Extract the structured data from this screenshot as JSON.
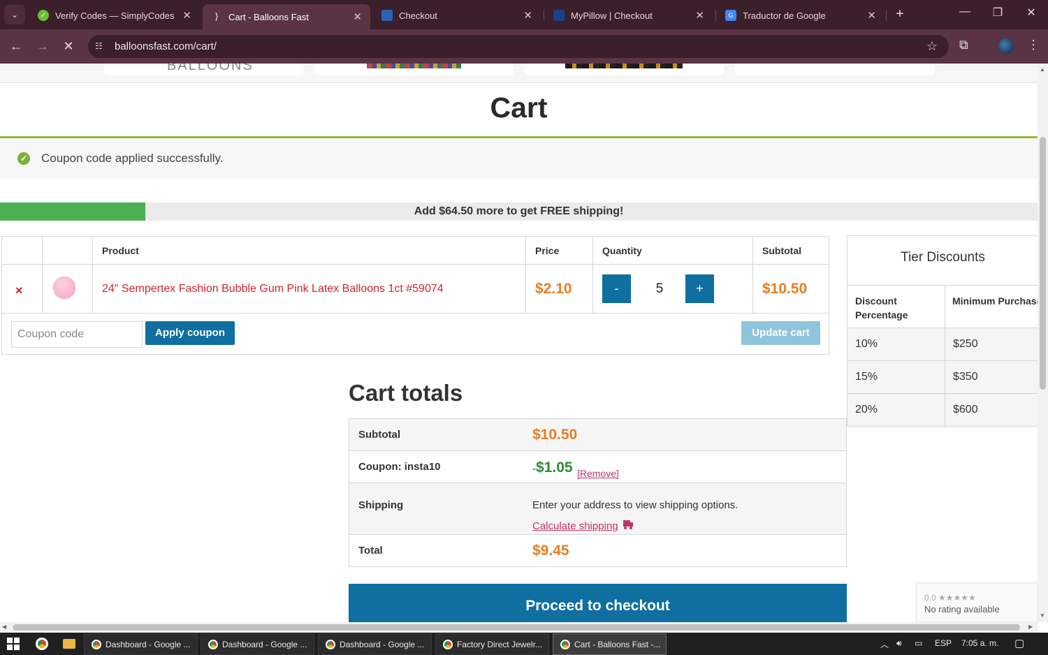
{
  "browser": {
    "tabs": [
      {
        "title": "Verify Codes — SimplyCodes",
        "active": false
      },
      {
        "title": "Cart - Balloons Fast",
        "active": true
      },
      {
        "title": "Checkout",
        "active": false
      },
      {
        "title": "MyPillow | Checkout",
        "active": false
      },
      {
        "title": "Traductor de Google",
        "active": false
      }
    ],
    "url": "balloonsfast.com/cart/",
    "icons": {
      "back": "back-arrow-icon",
      "forward": "forward-arrow-icon",
      "stop": "stop-loading-icon",
      "bookmark": "star-icon",
      "extensions": "puzzle-icon",
      "menu": "kebab-menu-icon"
    },
    "theme_color": "#5a3444"
  },
  "page": {
    "top_logo_text": "BALLOONS",
    "title": "Cart",
    "notice": "Coupon code applied successfully.",
    "shipping_progress": {
      "message": "Add $64.50 more to get FREE shipping!",
      "fraction": 0.14
    }
  },
  "cart_table": {
    "headers": {
      "product": "Product",
      "price": "Price",
      "quantity": "Quantity",
      "subtotal": "Subtotal"
    },
    "item": {
      "remove": "×",
      "name": "24\" Sempertex Fashion Bubble Gum Pink Latex Balloons 1ct #59074",
      "price": "$2.10",
      "qty_minus": "-",
      "quantity": "5",
      "qty_plus": "+",
      "subtotal": "$10.50"
    },
    "coupon_placeholder": "Coupon code",
    "apply_coupon": "Apply coupon",
    "update_cart": "Update cart"
  },
  "tier_discounts": {
    "title": "Tier Discounts",
    "col_discount": "Discount Percentage",
    "col_min": "Minimum Purchase Amt",
    "rows": [
      {
        "pct": "10%",
        "min": "$250"
      },
      {
        "pct": "15%",
        "min": "$350"
      },
      {
        "pct": "20%",
        "min": "$600"
      }
    ]
  },
  "cart_totals": {
    "title": "Cart totals",
    "subtotal_label": "Subtotal",
    "subtotal": "$10.50",
    "coupon_label": "Coupon: insta10",
    "coupon_sign": "-",
    "coupon_amount": "$1.05",
    "remove_label": "[Remove]",
    "shipping_label": "Shipping",
    "shipping_note": "Enter your address to view shipping options.",
    "calculate_shipping": "Calculate shipping",
    "total_label": "Total",
    "total": "$9.45",
    "proceed": "Proceed to checkout"
  },
  "rating_widget": {
    "score": "0.0 ★★★★★",
    "text": "No rating available"
  },
  "taskbar": {
    "items": [
      {
        "title": "Dashboard - Google ...",
        "active": false
      },
      {
        "title": "Dashboard - Google ...",
        "active": false
      },
      {
        "title": "Dashboard - Google ...",
        "active": false
      },
      {
        "title": "Factory Direct Jewelr...",
        "active": false
      },
      {
        "title": "Cart - Balloons Fast -...",
        "active": true
      }
    ],
    "lang": "ESP",
    "time": "7:05 a. m."
  }
}
